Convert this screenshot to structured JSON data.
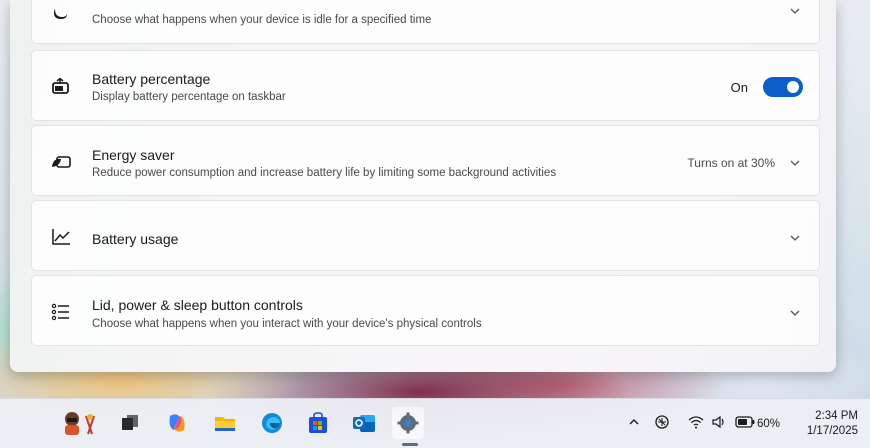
{
  "settings": {
    "sleep_card": {
      "description": "Choose what happens when your device is idle for a specified time"
    },
    "battery_percentage": {
      "title": "Battery percentage",
      "description": "Display battery percentage on taskbar",
      "toggle_label": "On",
      "toggle_state": true
    },
    "energy_saver": {
      "title": "Energy saver",
      "description": "Reduce power consumption and increase battery life by limiting some background activities",
      "status": "Turns on at 30%"
    },
    "battery_usage": {
      "title": "Battery usage"
    },
    "lid_power": {
      "title": "Lid, power & sleep button controls",
      "description": "Choose what happens when you interact with your device's physical controls"
    }
  },
  "taskbar": {
    "apps": [
      "avatar-widget",
      "task-view",
      "copilot",
      "file-explorer",
      "edge",
      "microsoft-store",
      "outlook",
      "settings"
    ],
    "tray": {
      "battery_percent": "60%",
      "time": "2:34 PM",
      "date": "1/17/2025"
    }
  },
  "colors": {
    "accent": "#0a5fc9"
  }
}
